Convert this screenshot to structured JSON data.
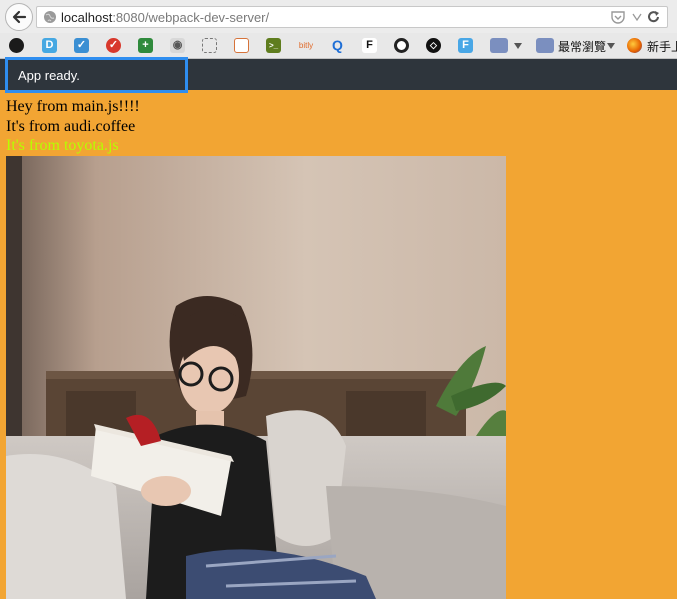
{
  "browser": {
    "url_host": "localhost",
    "url_rest": ":8080/webpack-dev-server/"
  },
  "bookmarks": {
    "folder_label": "最常瀏覽",
    "newbie_label": "新手上"
  },
  "notification": {
    "text": "App ready."
  },
  "content": {
    "line1": "Hey from main.js!!!!",
    "line2": "It's from audi.coffee",
    "line3": "It's from toyota.js",
    "line3_color": "#b6ff00"
  },
  "colors": {
    "page_background": "#f2a533",
    "notification_border": "#2f8ef0",
    "notification_background": "#2e353c"
  },
  "photo": {
    "description_icon": "photo-woman-reading-on-sofa"
  }
}
